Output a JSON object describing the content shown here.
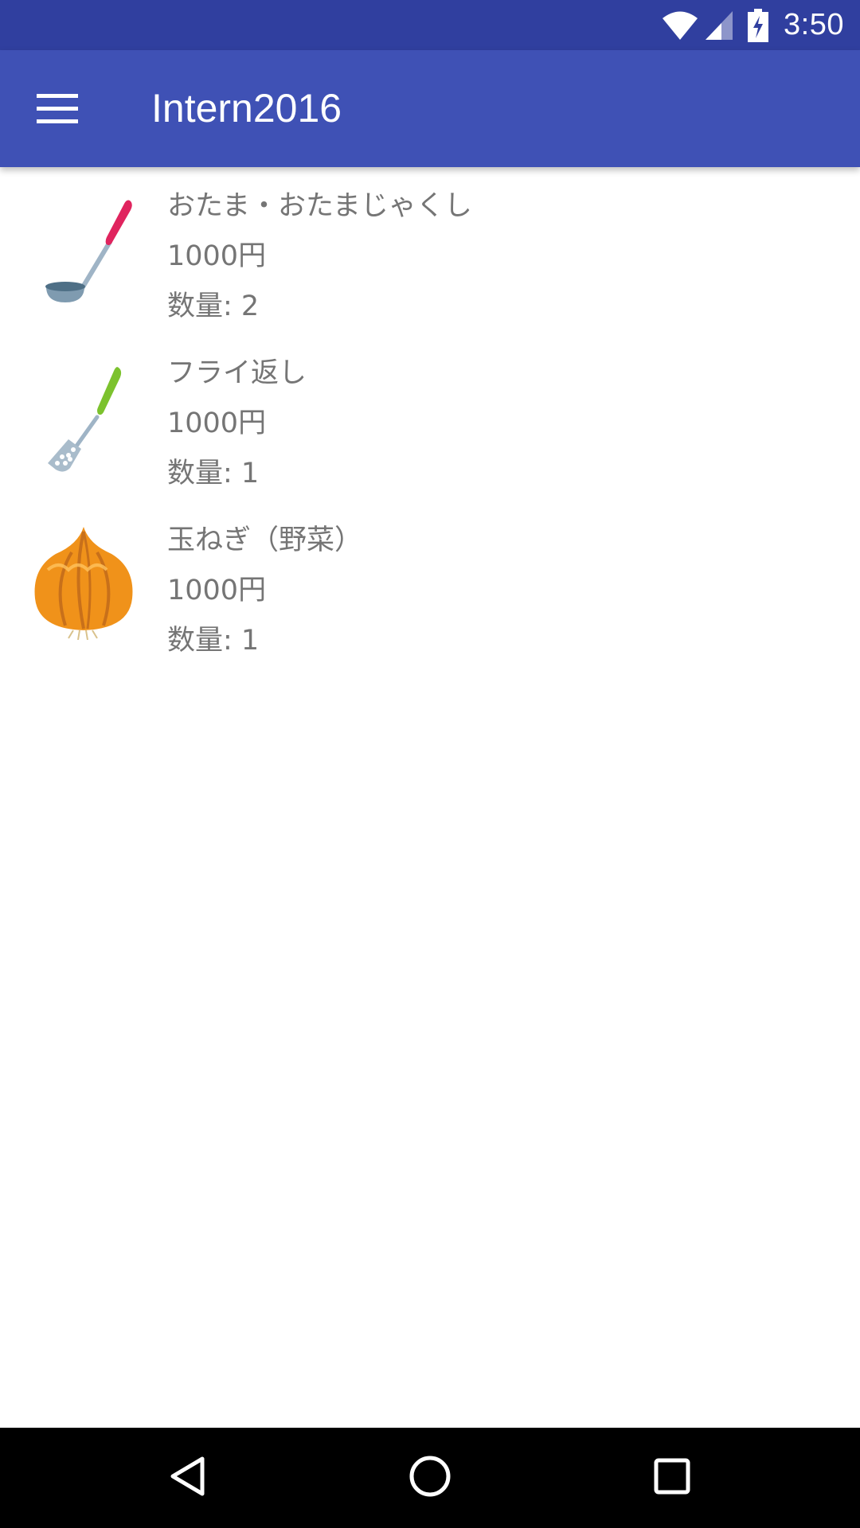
{
  "status_bar": {
    "time": "3:50",
    "icons": [
      "wifi-icon",
      "cellular-signal-icon",
      "battery-charging-icon"
    ]
  },
  "app_bar": {
    "title": "Intern2016",
    "menu_icon": "hamburger-menu-icon"
  },
  "items": [
    {
      "name": "おたま・おたまじゃくし",
      "price": "1000円",
      "quantity": "数量: 2",
      "icon": "ladle-icon"
    },
    {
      "name": "フライ返し",
      "price": "1000円",
      "quantity": "数量: 1",
      "icon": "spatula-icon"
    },
    {
      "name": "玉ねぎ（野菜）",
      "price": "1000円",
      "quantity": "数量: 1",
      "icon": "onion-icon"
    }
  ],
  "nav_bar": {
    "buttons": [
      "back-icon",
      "home-icon",
      "recents-icon"
    ]
  },
  "colors": {
    "status_bar": "#303F9F",
    "app_bar": "#3F51B5",
    "item_text": "#757575",
    "nav_bar": "#000000"
  }
}
